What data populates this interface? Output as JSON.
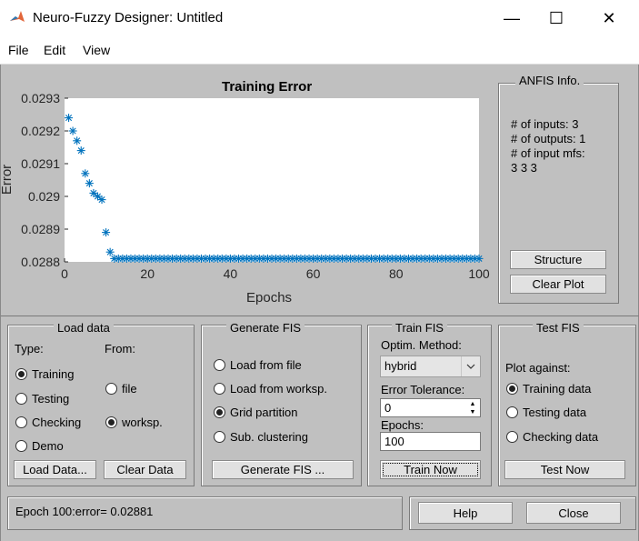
{
  "window": {
    "title": "Neuro-Fuzzy Designer: Untitled",
    "minimize": "—",
    "maximize": "☐",
    "close": "✕"
  },
  "menu": {
    "file": "File",
    "edit": "Edit",
    "view": "View"
  },
  "plot": {
    "title": "Training Error",
    "xlabel": "Epochs",
    "ylabel": "Error"
  },
  "anfis": {
    "title": "ANFIS Info.",
    "inputs": "# of inputs: 3",
    "outputs": "# of outputs: 1",
    "mfs_label": "# of input mfs:",
    "mfs_values": "3  3  3",
    "structure_btn": "Structure",
    "clear_plot_btn": "Clear Plot"
  },
  "load_data": {
    "title": "Load data",
    "type_label": "Type:",
    "from_label": "From:",
    "types": [
      {
        "label": "Training",
        "selected": true
      },
      {
        "label": "Testing",
        "selected": false
      },
      {
        "label": "Checking",
        "selected": false
      },
      {
        "label": "Demo",
        "selected": false
      }
    ],
    "from": [
      {
        "label": "file",
        "selected": false
      },
      {
        "label": "worksp.",
        "selected": true
      }
    ],
    "load_btn": "Load Data...",
    "clear_btn": "Clear Data"
  },
  "generate_fis": {
    "title": "Generate FIS",
    "options": [
      {
        "label": "Load from file",
        "selected": false
      },
      {
        "label": "Load from worksp.",
        "selected": false
      },
      {
        "label": "Grid partition",
        "selected": true
      },
      {
        "label": "Sub. clustering",
        "selected": false
      }
    ],
    "button": "Generate FIS ..."
  },
  "train_fis": {
    "title": "Train FIS",
    "method_label": "Optim. Method:",
    "method_value": "hybrid",
    "tolerance_label": "Error Tolerance:",
    "tolerance_value": "0",
    "epochs_label": "Epochs:",
    "epochs_value": "100",
    "button": "Train Now"
  },
  "test_fis": {
    "title": "Test FIS",
    "plot_against": "Plot against:",
    "options": [
      {
        "label": "Training data",
        "selected": true
      },
      {
        "label": "Testing data",
        "selected": false
      },
      {
        "label": "Checking data",
        "selected": false
      }
    ],
    "button": "Test Now"
  },
  "status": {
    "text": "Epoch 100:error= 0.02881"
  },
  "buttons": {
    "help": "Help",
    "close": "Close"
  },
  "colors": {
    "marker": "#0072bd",
    "background": "#c0c0c0"
  },
  "chart_data": {
    "type": "scatter",
    "title": "Training Error",
    "xlabel": "Epochs",
    "ylabel": "Error",
    "xlim": [
      0,
      100
    ],
    "ylim": [
      0.0288,
      0.0293
    ],
    "xticks": [
      "0",
      "20",
      "40",
      "60",
      "80",
      "100"
    ],
    "yticks": [
      "0.0288",
      "0.0289",
      "0.029",
      "0.0291",
      "0.0292",
      "0.0293"
    ],
    "marker": "asterisk",
    "series": [
      {
        "x": [
          1,
          2,
          3,
          4,
          5,
          6,
          7,
          8,
          9,
          10,
          11,
          12,
          13,
          14,
          15,
          16,
          17,
          18,
          19,
          20,
          21,
          22,
          23,
          24,
          25,
          26,
          27,
          28,
          29,
          30,
          31,
          32,
          33,
          34,
          35,
          36,
          37,
          38,
          39,
          40,
          41,
          42,
          43,
          44,
          45,
          46,
          47,
          48,
          49,
          50,
          51,
          52,
          53,
          54,
          55,
          56,
          57,
          58,
          59,
          60,
          61,
          62,
          63,
          64,
          65,
          66,
          67,
          68,
          69,
          70,
          71,
          72,
          73,
          74,
          75,
          76,
          77,
          78,
          79,
          80,
          81,
          82,
          83,
          84,
          85,
          86,
          87,
          88,
          89,
          90,
          91,
          92,
          93,
          94,
          95,
          96,
          97,
          98,
          99,
          100
        ],
        "values": [
          0.02924,
          0.0292,
          0.02917,
          0.02914,
          0.02907,
          0.02904,
          0.02901,
          0.029,
          0.02899,
          0.02889,
          0.02883,
          0.02881,
          0.02881,
          0.02881,
          0.02881,
          0.02881,
          0.02881,
          0.02881,
          0.02881,
          0.02881,
          0.02881,
          0.02881,
          0.02881,
          0.02881,
          0.02881,
          0.02881,
          0.02881,
          0.02881,
          0.02881,
          0.02881,
          0.02881,
          0.02881,
          0.02881,
          0.02881,
          0.02881,
          0.02881,
          0.02881,
          0.02881,
          0.02881,
          0.02881,
          0.02881,
          0.02881,
          0.02881,
          0.02881,
          0.02881,
          0.02881,
          0.02881,
          0.02881,
          0.02881,
          0.02881,
          0.02881,
          0.02881,
          0.02881,
          0.02881,
          0.02881,
          0.02881,
          0.02881,
          0.02881,
          0.02881,
          0.02881,
          0.02881,
          0.02881,
          0.02881,
          0.02881,
          0.02881,
          0.02881,
          0.02881,
          0.02881,
          0.02881,
          0.02881,
          0.02881,
          0.02881,
          0.02881,
          0.02881,
          0.02881,
          0.02881,
          0.02881,
          0.02881,
          0.02881,
          0.02881,
          0.02881,
          0.02881,
          0.02881,
          0.02881,
          0.02881,
          0.02881,
          0.02881,
          0.02881,
          0.02881,
          0.02881,
          0.02881,
          0.02881,
          0.02881,
          0.02881,
          0.02881,
          0.02881,
          0.02881,
          0.02881,
          0.02881,
          0.02881
        ]
      }
    ]
  }
}
